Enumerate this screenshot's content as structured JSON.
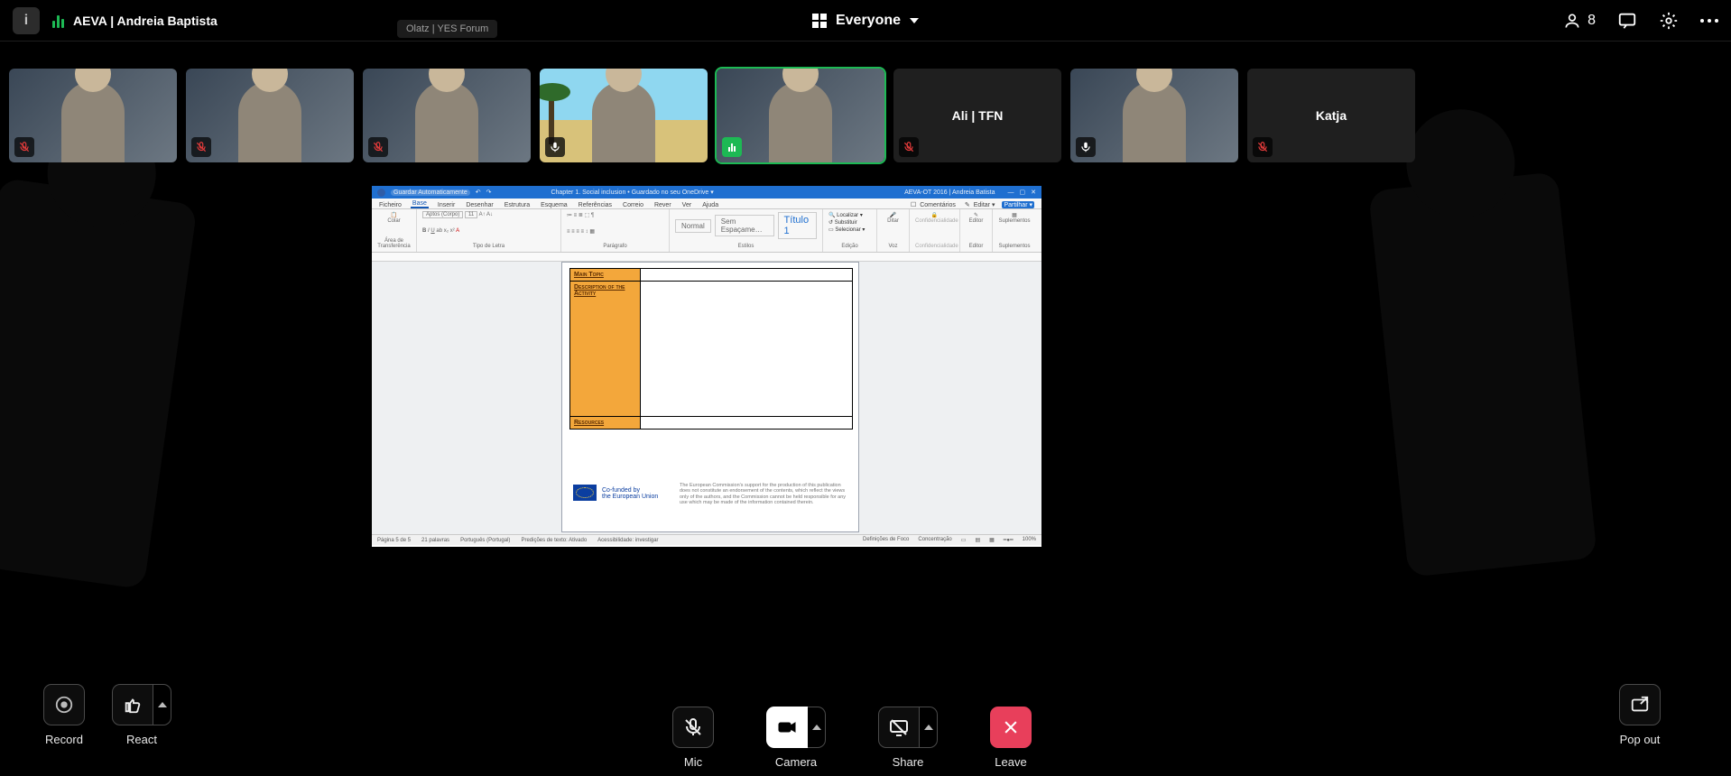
{
  "topbar": {
    "active_speaker": "AEVA | Andreia Baptista",
    "layout_label": "Everyone",
    "participant_count": "8",
    "hover_tooltip": "Olatz | YES Forum"
  },
  "tiles": [
    {
      "name": "",
      "type": "video",
      "mic": "muted"
    },
    {
      "name": "",
      "type": "video",
      "mic": "muted"
    },
    {
      "name": "",
      "type": "video",
      "mic": "muted"
    },
    {
      "name": "",
      "type": "beach",
      "mic": "live"
    },
    {
      "name": "",
      "type": "video",
      "mic": "speaking",
      "active": true
    },
    {
      "name": "Ali | TFN",
      "type": "avatar",
      "mic": "muted"
    },
    {
      "name": "",
      "type": "video",
      "mic": "live"
    },
    {
      "name": "Katja",
      "type": "avatar",
      "mic": "muted"
    }
  ],
  "word": {
    "autosave": "Guardar Automaticamente",
    "filename": "Chapter 1. Social inclusion • Guardado no seu OneDrive ▾",
    "account": "AEVA-OT 2016 | Andreia Batista",
    "tabs": [
      "Ficheiro",
      "Base",
      "Inserir",
      "Desenhar",
      "Estrutura",
      "Esquema",
      "Referências",
      "Correio",
      "Rever",
      "Ver",
      "Ajuda"
    ],
    "tabs_selected": "Base",
    "comments_btn": "Comentários",
    "edit_btn": "Editar ▾",
    "share_btn": "Partilhar ▾",
    "ribbon": {
      "clipboard_caption": "Área de Transferência",
      "paste": "Colar",
      "font_name": "Aptos (Corpo)",
      "font_size": "11",
      "font_caption": "Tipo de Letra",
      "paragraph_caption": "Parágrafo",
      "styles": [
        "Normal",
        "Sem Espaçame…",
        "Título 1"
      ],
      "styles_caption": "Estilos",
      "editing": [
        "Localizar ▾",
        "Substituir",
        "Selecionar ▾"
      ],
      "editing_caption": "Edição",
      "voice_caption": "Voz",
      "voice": "Ditar",
      "sensitivity_caption": "Confidencialidade",
      "sensitivity": "Confidencialidade",
      "editor_caption": "Editor",
      "editor": "Editor",
      "addins_caption": "Suplementos",
      "addins": "Suplementos"
    },
    "doc": {
      "row1": "Main Topic",
      "row2": "Description of the Activity",
      "row3": "Resources",
      "cofunded_l1": "Co-funded by",
      "cofunded_l2": "the European Union",
      "disclaimer": "The European Commission's support for the production of this publication does not constitute an endorsement of the contents, which reflect the views only of the authors, and the Commission cannot be held responsible for any use which may be made of the information contained therein."
    },
    "status": {
      "page": "Página 5 de 5",
      "words": "21 palavras",
      "lang": "Português (Portugal)",
      "predict": "Predições de texto: Ativado",
      "a11y": "Acessibilidade: investigar",
      "focus": "Definições de Foco",
      "concentrate": "Concentração",
      "zoom": "100%"
    }
  },
  "toolbar": {
    "record": "Record",
    "react": "React",
    "mic": "Mic",
    "camera": "Camera",
    "share": "Share",
    "leave": "Leave",
    "popout": "Pop out"
  }
}
